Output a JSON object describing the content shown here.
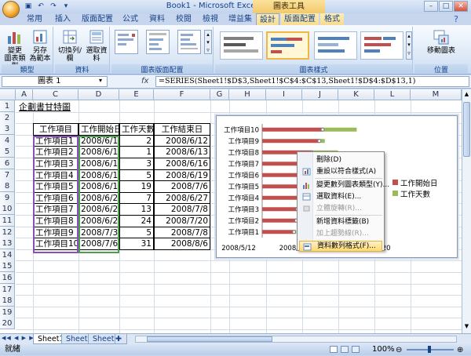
{
  "title_bar": {
    "title": "Book1 - Microsoft Excel",
    "context_tool": "圖表工具"
  },
  "tabs": [
    "常用",
    "插入",
    "版面配置",
    "公式",
    "資料",
    "校閱",
    "檢視",
    "增益集",
    "設計",
    "版面配置",
    "格式"
  ],
  "active_tab_index": 8,
  "ribbon": {
    "groups": {
      "type": "類型",
      "data": "資料",
      "layout": "圖表版面配置",
      "style": "圖表樣式",
      "location": "位置"
    },
    "buttons": {
      "change_type": "變更\n圖表類型",
      "save_template": "另存\n為範本",
      "switch_row_col": "切換列/欄",
      "select_data": "選取資料",
      "move_chart": "移動圖表"
    }
  },
  "formula_bar": {
    "name_box": "圖表 1",
    "fx": "fx",
    "formula": "=SERIES(Sheet1!$D$3,Sheet1!$C$4:$C$13,Sheet1!$D$4:$D$13,1)"
  },
  "columns": [
    "A",
    "C",
    "D",
    "E",
    "F",
    "G",
    "H",
    "I",
    "J",
    "K",
    "L",
    "M"
  ],
  "rows": [
    "1",
    "2",
    "3",
    "4",
    "5",
    "6",
    "7",
    "8",
    "9",
    "10",
    "11",
    "12",
    "13",
    "14",
    "15",
    "16",
    "17",
    "18",
    "19",
    "20"
  ],
  "sheet_title": "企劃書甘特圖",
  "table": {
    "headers": [
      "工作項目",
      "工作開始日",
      "工作天數",
      "工作結束日"
    ],
    "rows": [
      [
        "工作項目1",
        "2008/6/10",
        "2",
        "2008/6/12"
      ],
      [
        "工作項目2",
        "2008/6/12",
        "1",
        "2008/6/13"
      ],
      [
        "工作項目3",
        "2008/6/13",
        "3",
        "2008/6/16"
      ],
      [
        "工作項目4",
        "2008/6/14",
        "5",
        "2008/6/19"
      ],
      [
        "工作項目5",
        "2008/6/17",
        "19",
        "2008/7/6"
      ],
      [
        "工作項目6",
        "2008/6/20",
        "7",
        "2008/6/27"
      ],
      [
        "工作項目7",
        "2008/6/25",
        "13",
        "2008/7/8"
      ],
      [
        "工作項目8",
        "2008/6/26",
        "24",
        "2008/7/20"
      ],
      [
        "工作項目9",
        "2008/7/3",
        "5",
        "2008/7/8"
      ],
      [
        "工作項目10",
        "2008/7/6",
        "31",
        "2008/8/6"
      ]
    ]
  },
  "chart_data": {
    "type": "bar",
    "orientation": "horizontal",
    "stacked": true,
    "categories": [
      "工作項目10",
      "工作項目9",
      "工作項目8",
      "工作項目7",
      "工作項目6",
      "工作項目5",
      "工作項目4",
      "工作項目3",
      "工作項目2",
      "工作項目1"
    ],
    "series": [
      {
        "name": "工作開始日",
        "color": "#c0504d",
        "values": [
          "2008/7/6",
          "2008/7/3",
          "2008/6/26",
          "2008/6/25",
          "2008/6/20",
          "2008/6/17",
          "2008/6/14",
          "2008/6/13",
          "2008/6/12",
          "2008/6/10"
        ]
      },
      {
        "name": "工作天數",
        "color": "#9bbb59",
        "values": [
          31,
          5,
          24,
          13,
          7,
          19,
          5,
          3,
          1,
          2
        ]
      }
    ],
    "x_tick_labels": [
      "2008/5/12",
      "2008/6/",
      "8/20"
    ],
    "legend_position": "right"
  },
  "context_menu": {
    "items": [
      {
        "label": "刪除(D)",
        "disabled": false,
        "icon": "none"
      },
      {
        "label": "重設以符合樣式(A)",
        "disabled": false,
        "icon": "reset-icon"
      },
      {
        "label": "變更數列圖表類型(Y)...",
        "disabled": false,
        "icon": "chart-type-icon"
      },
      {
        "label": "選取資料(E)...",
        "disabled": false,
        "icon": "select-data-icon"
      },
      {
        "label": "立體旋轉(R)...",
        "disabled": true,
        "icon": "rotate-icon"
      },
      {
        "label": "新增資料標籤(B)",
        "disabled": false,
        "icon": "none"
      },
      {
        "label": "加上趨勢線(R)...",
        "disabled": true,
        "icon": "none"
      },
      {
        "label": "資料數列格式(F)...",
        "disabled": false,
        "icon": "format-icon",
        "highlighted": true
      }
    ]
  },
  "sheets": [
    "Sheet1",
    "Sheet2",
    "Sheet3"
  ],
  "active_sheet_index": 0,
  "status": {
    "ready": "就緒",
    "zoom": "100%"
  }
}
